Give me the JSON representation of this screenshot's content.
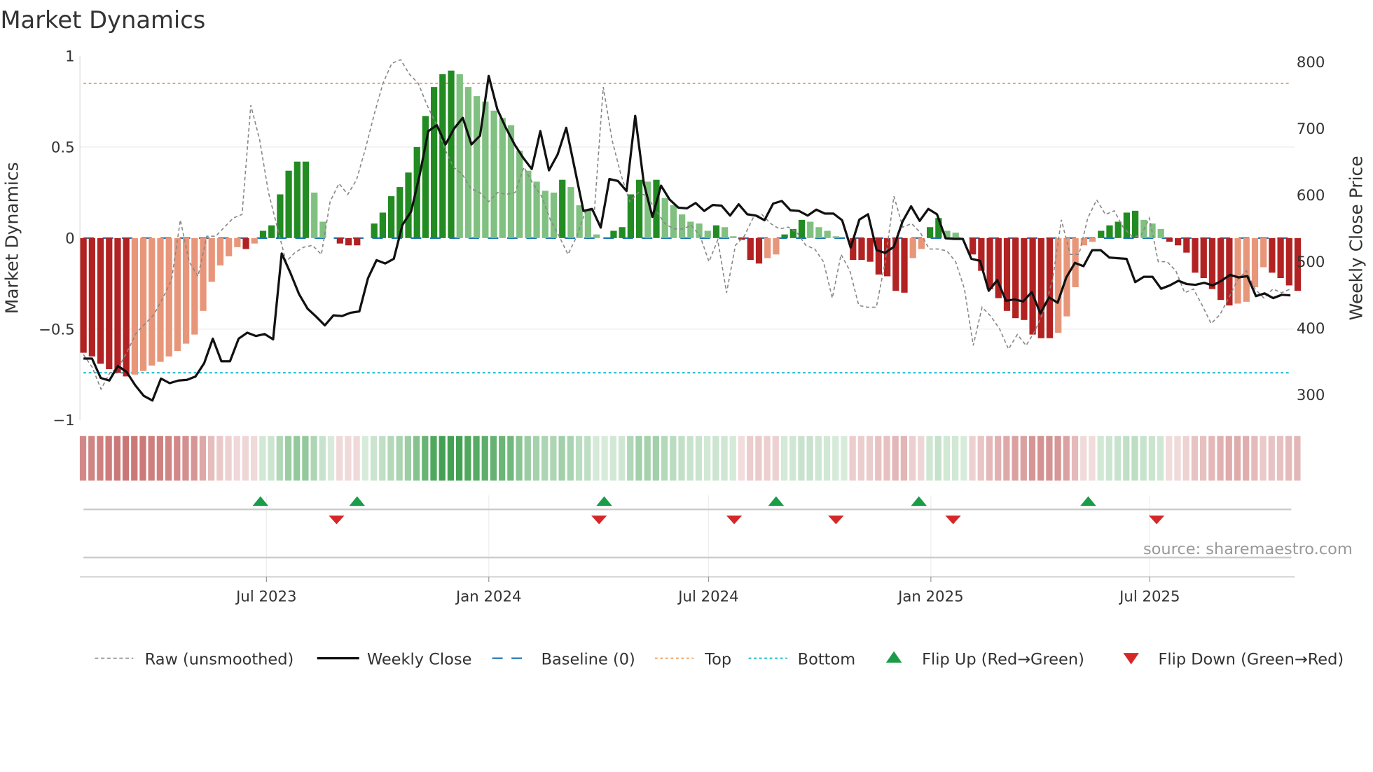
{
  "chart_data": {
    "type": "bar",
    "title": "Market Dynamics",
    "ylabel": "Market Dynamics",
    "y2label": "Weekly Close Price",
    "ylim": [
      -1,
      1
    ],
    "y2lim": [
      250,
      810
    ],
    "yticks": [
      {
        "v": 1,
        "label": "1"
      },
      {
        "v": 0.5,
        "label": "0.5"
      },
      {
        "v": 0,
        "label": "0"
      },
      {
        "v": -0.5,
        "label": "−0.5"
      },
      {
        "v": -1,
        "label": "−1"
      }
    ],
    "y2ticks": [
      {
        "v": 800,
        "label": "800"
      },
      {
        "v": 700,
        "label": "700"
      },
      {
        "v": 600,
        "label": "600"
      },
      {
        "v": 500,
        "label": "500"
      },
      {
        "v": 400,
        "label": "400"
      },
      {
        "v": 300,
        "label": "300"
      }
    ],
    "x_unit": "week index",
    "xticks": [
      {
        "week": 21.4,
        "label": "Jul 2023"
      },
      {
        "week": 47.4,
        "label": "Jan 2024"
      },
      {
        "week": 73.1,
        "label": "Jul 2024"
      },
      {
        "week": 99.1,
        "label": "Jan 2025"
      },
      {
        "week": 124.7,
        "label": "Jul 2025"
      }
    ],
    "top_level": 0.85,
    "bottom_level": -0.74,
    "baseline": 0,
    "bars": [
      -0.63,
      -0.65,
      -0.69,
      -0.72,
      -0.74,
      -0.76,
      -0.75,
      -0.73,
      -0.7,
      -0.68,
      -0.65,
      -0.62,
      -0.58,
      -0.53,
      -0.4,
      -0.24,
      -0.15,
      -0.1,
      -0.05,
      -0.06,
      -0.03,
      0.04,
      0.07,
      0.24,
      0.37,
      0.42,
      0.42,
      0.25,
      0.09,
      0.0,
      -0.03,
      -0.04,
      -0.04,
      0.0,
      0.08,
      0.14,
      0.23,
      0.28,
      0.36,
      0.5,
      0.67,
      0.83,
      0.9,
      0.92,
      0.9,
      0.83,
      0.78,
      0.75,
      0.7,
      0.66,
      0.62,
      0.48,
      0.37,
      0.31,
      0.26,
      0.25,
      0.32,
      0.28,
      0.18,
      0.15,
      0.02,
      0.0,
      0.04,
      0.06,
      0.24,
      0.32,
      0.31,
      0.32,
      0.22,
      0.18,
      0.13,
      0.09,
      0.08,
      0.04,
      0.07,
      0.06,
      0.01,
      -0.01,
      -0.12,
      -0.14,
      -0.11,
      -0.09,
      0.02,
      0.05,
      0.1,
      0.09,
      0.06,
      0.04,
      0.01,
      0.0,
      -0.12,
      -0.12,
      -0.13,
      -0.2,
      -0.21,
      -0.29,
      -0.3,
      -0.11,
      -0.06,
      0.06,
      0.11,
      0.04,
      0.03,
      0.0,
      -0.09,
      -0.18,
      -0.28,
      -0.33,
      -0.4,
      -0.44,
      -0.45,
      -0.53,
      -0.55,
      -0.55,
      -0.52,
      -0.43,
      -0.27,
      -0.04,
      -0.02,
      0.04,
      0.07,
      0.09,
      0.14,
      0.15,
      0.1,
      0.08,
      0.05,
      -0.02,
      -0.04,
      -0.08,
      -0.19,
      -0.22,
      -0.28,
      -0.34,
      -0.37,
      -0.36,
      -0.35,
      -0.27,
      -0.16,
      -0.19,
      -0.22,
      -0.26,
      -0.29
    ],
    "raw": [
      -0.64,
      -0.71,
      -0.83,
      -0.74,
      -0.71,
      -0.62,
      -0.52,
      -0.47,
      -0.42,
      -0.33,
      -0.23,
      0.1,
      -0.13,
      -0.21,
      0.01,
      0.01,
      0.06,
      0.11,
      0.13,
      0.73,
      0.54,
      0.25,
      0.06,
      -0.13,
      -0.08,
      -0.05,
      -0.04,
      -0.09,
      0.2,
      0.3,
      0.24,
      0.32,
      0.49,
      0.68,
      0.85,
      0.96,
      0.98,
      0.9,
      0.85,
      0.73,
      0.63,
      0.49,
      0.39,
      0.35,
      0.27,
      0.25,
      0.2,
      0.25,
      0.24,
      0.25,
      0.39,
      0.3,
      0.23,
      0.1,
      0.01,
      -0.09,
      0.01,
      0.15,
      0.15,
      0.83,
      0.54,
      0.35,
      0.2,
      0.25,
      0.23,
      0.15,
      0.08,
      0.05,
      0.05,
      0.07,
      0.01,
      -0.13,
      -0.01,
      -0.3,
      -0.04,
      0.01,
      0.11,
      0.13,
      0.08,
      0.05,
      0.06,
      0.03,
      -0.04,
      -0.06,
      -0.13,
      -0.33,
      -0.09,
      -0.18,
      -0.37,
      -0.38,
      -0.38,
      -0.13,
      0.23,
      0.06,
      0.08,
      0.03,
      -0.06,
      -0.06,
      -0.07,
      -0.13,
      -0.28,
      -0.59,
      -0.38,
      -0.43,
      -0.5,
      -0.61,
      -0.53,
      -0.59,
      -0.51,
      -0.4,
      -0.23,
      0.1,
      -0.09,
      -0.09,
      0.11,
      0.21,
      0.13,
      0.15,
      0.06,
      0.01,
      0.01,
      0.11,
      -0.13,
      -0.13,
      -0.18,
      -0.3,
      -0.28,
      -0.37,
      -0.47,
      -0.42,
      -0.33,
      -0.23,
      -0.18,
      -0.28,
      -0.33,
      -0.28,
      -0.3,
      -0.28
    ],
    "weekly_close": [
      353,
      353,
      324,
      320,
      342,
      333,
      313,
      297,
      290,
      323,
      316,
      320,
      321,
      326,
      346,
      383,
      349,
      349,
      383,
      392,
      387,
      390,
      382,
      511,
      482,
      450,
      428,
      416,
      403,
      418,
      417,
      422,
      424,
      474,
      501,
      496,
      503,
      554,
      574,
      629,
      695,
      704,
      675,
      699,
      715,
      675,
      688,
      778,
      728,
      700,
      675,
      655,
      638,
      695,
      636,
      660,
      700,
      638,
      575,
      578,
      550,
      623,
      620,
      605,
      718,
      616,
      566,
      613,
      592,
      580,
      579,
      587,
      575,
      584,
      583,
      568,
      585,
      570,
      568,
      561,
      586,
      590,
      576,
      575,
      568,
      577,
      571,
      571,
      561,
      520,
      562,
      570,
      516,
      512,
      521,
      559,
      582,
      560,
      578,
      570,
      534,
      533,
      533,
      503,
      500,
      455,
      471,
      440,
      442,
      439,
      453,
      421,
      445,
      437,
      475,
      497,
      492,
      516,
      516,
      505,
      504,
      503,
      468,
      476,
      476,
      458,
      463,
      470,
      465,
      464,
      467,
      463,
      470,
      479,
      475,
      477,
      447,
      451,
      444,
      449,
      448
    ],
    "flip_up_weeks": [
      20.7,
      32.0,
      60.9,
      81.0,
      97.7,
      117.5
    ],
    "flip_down_weeks": [
      29.6,
      60.3,
      76.1,
      88.0,
      101.7,
      125.5
    ],
    "legend": [
      {
        "label": "Raw (unsmoothed)",
        "style": "raw"
      },
      {
        "label": "Weekly Close",
        "style": "close"
      },
      {
        "label": "Baseline (0)",
        "style": "baseline"
      },
      {
        "label": "Top",
        "style": "top"
      },
      {
        "label": "Bottom",
        "style": "bottom"
      },
      {
        "label": "Flip Up (Red→Green)",
        "style": "up"
      },
      {
        "label": "Flip Down (Green→Red)",
        "style": "down"
      }
    ],
    "legend_position": "bottom",
    "source": "source: sharemaestro.com",
    "colors": {
      "green_strong": "#228b22",
      "green_weak": "#80c080",
      "red_strong": "#b22222",
      "red_weak": "#e8967a",
      "raw": "#888888",
      "close": "#111111",
      "baseline": "#1f77b4",
      "top": "#f4a460",
      "bottom": "#17becf",
      "up": "#1a9c48",
      "down": "#d62728"
    }
  }
}
